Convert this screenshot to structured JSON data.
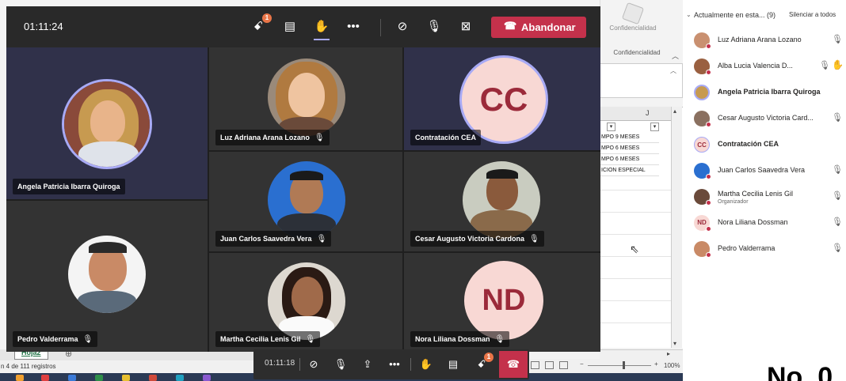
{
  "meeting": {
    "timer": "01:11:24",
    "leave_label": "Abandonar",
    "participants_badge": "1"
  },
  "tiles": [
    {
      "name": "Angela Patricia Ibarra Quiroga",
      "muted": false
    },
    {
      "name": "Luz Adriana Arana Lozano",
      "muted": true
    },
    {
      "name": "Contratación CEA",
      "muted": false,
      "initials": "CC"
    },
    {
      "name": "Juan Carlos Saavedra Vera",
      "muted": true
    },
    {
      "name": "Cesar Augusto Victoria Cardona",
      "muted": true
    },
    {
      "name": "Pedro Valderrama",
      "muted": true
    },
    {
      "name": "Martha Cecilia Lenis Gil",
      "muted": true
    },
    {
      "name": "Nora Liliana Dossman",
      "muted": true,
      "initials": "ND"
    }
  ],
  "floatbar": {
    "timer": "01:11:18",
    "participants_badge": "1"
  },
  "panel": {
    "title": "Actualmente en esta... (9)",
    "mute_all": "Silenciar a todos",
    "people": [
      {
        "name": "Luz Adriana Arana Lozano",
        "bold": false,
        "muted": true
      },
      {
        "name": "Alba Lucia Valencia D...",
        "bold": false,
        "muted": true,
        "hand": true
      },
      {
        "name": "Angela Patricia Ibarra Quiroga",
        "bold": true,
        "muted": false
      },
      {
        "name": "Cesar Augusto Victoria Card...",
        "bold": false,
        "muted": true
      },
      {
        "name": "Contratación CEA",
        "bold": true,
        "muted": false,
        "initials": "CC"
      },
      {
        "name": "Juan Carlos Saavedra Vera",
        "bold": false,
        "muted": true
      },
      {
        "name": "Martha Cecilia Lenis Gil",
        "bold": false,
        "muted": true,
        "sub": "Organizador"
      },
      {
        "name": "Nora Liliana Dossman",
        "bold": false,
        "muted": true,
        "initials": "ND"
      },
      {
        "name": "Pedro Valderrama",
        "bold": false,
        "muted": true
      }
    ]
  },
  "excel": {
    "confidential_btn": "Confidencialidad",
    "confidential_group": "Confidencialidad",
    "col_header": "J",
    "rows": [
      "MPO 9 MESES",
      "MPO 6 MESES",
      "MPO 6 MESES",
      "ICIÓN ESPECIAL"
    ],
    "sheet_tab": "Hoja2",
    "status": "n 4 de 111 registros",
    "zoom": "100%"
  },
  "doc_no": "No. 0",
  "colors": {
    "teams_bg": "#1f1f1f",
    "leave_red": "#c4314b",
    "accent": "#a8aaf5",
    "hand_yellow": "#e8a200"
  }
}
